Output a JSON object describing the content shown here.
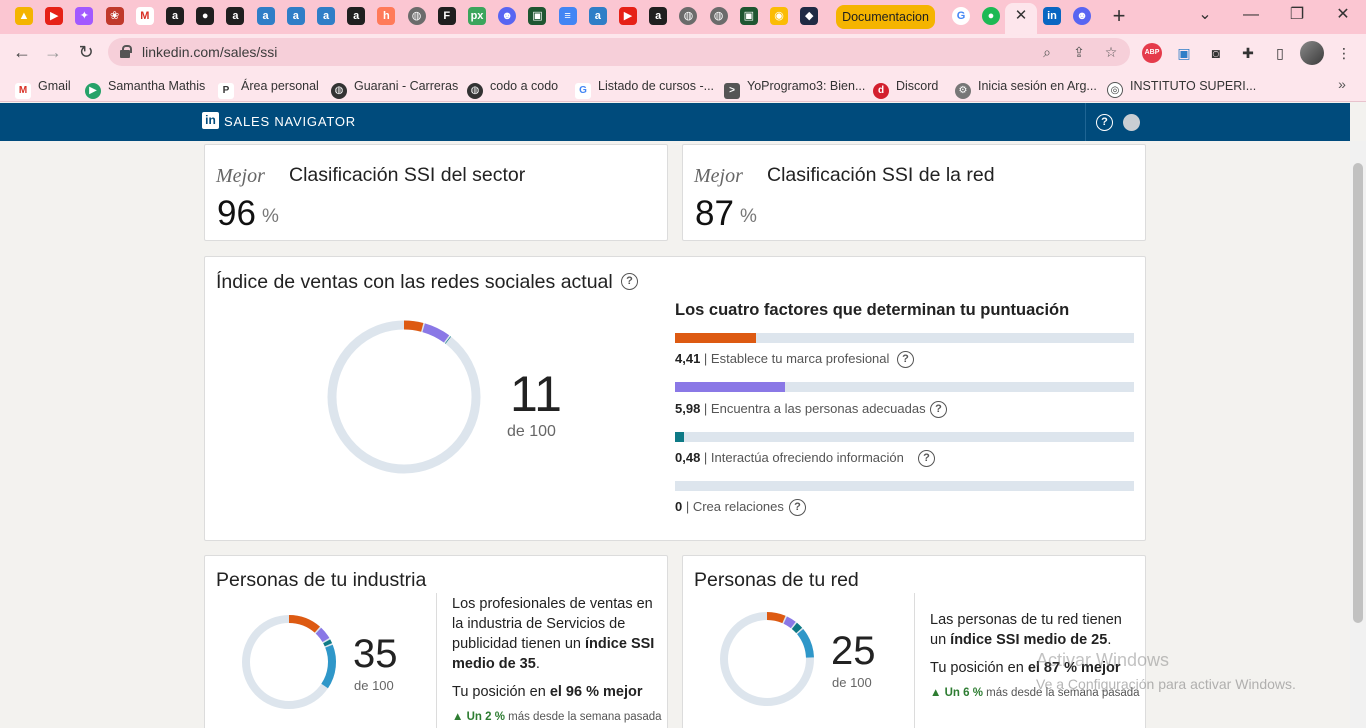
{
  "browser": {
    "active_tab_label": "Documentacion",
    "url": "linkedin.com/sales/ssi",
    "tab_icons": [
      "drive-icon",
      "youtube-icon",
      "figma-icon",
      "app-icon",
      "gmail-icon",
      "app-a-icon",
      "github-icon",
      "app-a-icon",
      "app-a-icon",
      "app-a-icon",
      "app-a-icon",
      "app-a-icon",
      "hubspot-icon",
      "globe-icon",
      "framer-icon",
      "px-icon",
      "reddit-icon",
      "terminal-icon",
      "docs-icon",
      "app-a-icon",
      "youtube-icon",
      "app-a-icon",
      "globe-icon",
      "globe-icon",
      "terminal-icon",
      "chrome-icon",
      "dark-icon"
    ],
    "bookmarks": [
      {
        "label": "Gmail",
        "icon": "gmail-icon"
      },
      {
        "label": "Samantha Mathis",
        "icon": "play-icon"
      },
      {
        "label": "Área personal",
        "icon": "p-icon"
      },
      {
        "label": "Guarani - Carreras",
        "icon": "globe-icon"
      },
      {
        "label": "codo a codo",
        "icon": "globe-icon"
      },
      {
        "label": "Listado de cursos -...",
        "icon": "google-icon"
      },
      {
        "label": "YoProgramo3: Bien...",
        "icon": "terminal-icon"
      },
      {
        "label": "Discord",
        "icon": "discord-icon"
      },
      {
        "label": "Inicia sesión en Arg...",
        "icon": "gear-icon"
      },
      {
        "label": "INSTITUTO SUPERI...",
        "icon": "institute-icon"
      }
    ]
  },
  "header": {
    "title": "SALES NAVIGATOR",
    "logo_text": "in"
  },
  "rankings": [
    {
      "prefix": "Mejor",
      "title": "Clasificación SSI del sector",
      "value": "96",
      "unit": "%"
    },
    {
      "prefix": "Mejor",
      "title": "Clasificación SSI de la red",
      "value": "87",
      "unit": "%"
    }
  ],
  "ssi": {
    "title": "Índice de ventas con las redes sociales actual",
    "score": "11",
    "of": "de 100",
    "factors_title": "Los cuatro factores que determinan tu puntuación",
    "factors": [
      {
        "value": "4,41",
        "label": "Establece tu marca profesional",
        "fraction": 0.1764,
        "color": "#dd5a12"
      },
      {
        "value": "5,98",
        "label": "Encuentra a las personas adecuadas",
        "fraction": 0.2392,
        "color": "#8a78e6"
      },
      {
        "value": "0,48",
        "label": "Interactúa ofreciendo información",
        "fraction": 0.0192,
        "color": "#0e7a86"
      },
      {
        "value": "0",
        "label": "Crea relaciones",
        "fraction": 0,
        "color": "#2f97c9"
      }
    ]
  },
  "industry": {
    "title": "Personas de tu industria",
    "score": "35",
    "of": "de 100",
    "text_pre": "Los profesionales de ventas en la industria de Servicios de publicidad tienen un ",
    "text_bold": "índice SSI medio de 35",
    "text_post": ".",
    "position_pre": "Tu posición en ",
    "position_bold": "el 96 % mejor",
    "trend_up": "▲ Un 2 %",
    "trend_text": "más desde la semana pasada"
  },
  "network": {
    "title": "Personas de tu red",
    "score": "25",
    "of": "de 100",
    "text_pre": "Las personas de tu red tienen un ",
    "text_bold": "índice SSI medio de 25",
    "text_post": ".",
    "position_pre": "Tu posición en ",
    "position_bold": "el 87 % mejor",
    "trend_up": "▲ Un 6 %",
    "trend_text": "más desde la semana pasada"
  },
  "watermark": {
    "line1": "Activar Windows",
    "line2": "Ve a Configuración para activar Windows."
  },
  "colors": {
    "header_bg": "#004b7c",
    "track": "#dde5ed",
    "orange": "#dd5a12",
    "purple": "#8a78e6",
    "teal": "#0e7a86",
    "blue": "#2f97c9"
  }
}
